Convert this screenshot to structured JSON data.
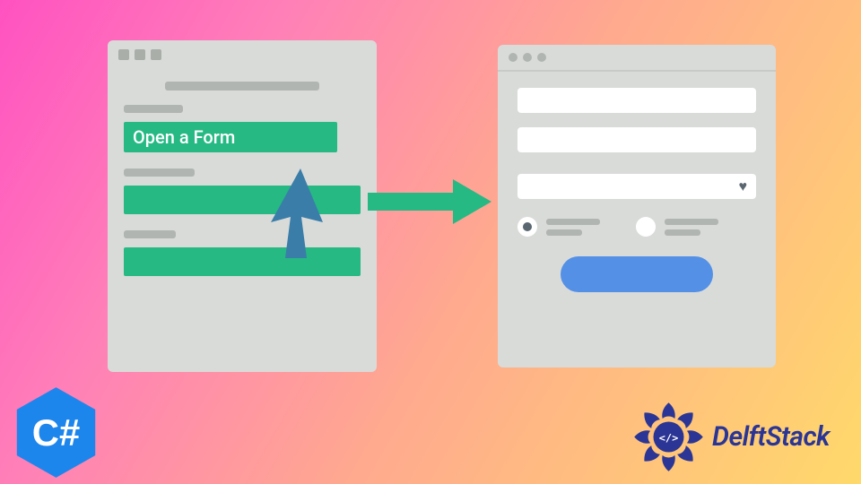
{
  "leftWindow": {
    "openFormLabel": "Open a Form"
  },
  "csharp": {
    "label": "C#"
  },
  "brand": {
    "name": "DelftStack"
  },
  "colors": {
    "green": "#26b983",
    "blue": "#5490e6",
    "csharpBlue": "#1d86ec",
    "delftBlue": "#2a3595",
    "cursorBlue": "#3a7da8"
  }
}
